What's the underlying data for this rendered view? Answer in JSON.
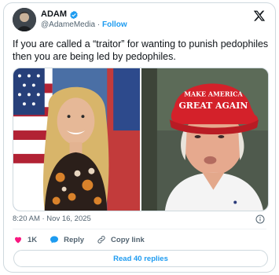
{
  "author": {
    "name": "ADAM",
    "handle": "@AdameMedia",
    "separator": "·",
    "follow_label": "Follow"
  },
  "post": {
    "text": "If you are called a “traitor” for wanting to punish pedophiles then you are being led by pedophiles."
  },
  "media": {
    "right_hat_text_line1": "MAKE AMERICA",
    "right_hat_text_line2": "GREAT AGAIN"
  },
  "timestamp": "8:20 AM · Nov 16, 2025",
  "actions": {
    "like_count": "1K",
    "reply_label": "Reply",
    "copy_label": "Copy link"
  },
  "replies_button": "Read 40 replies",
  "colors": {
    "accent": "#1d9bf0",
    "like": "#f91880",
    "hat": "#d4212a"
  },
  "icons": [
    "x-logo-icon",
    "verified-badge-icon",
    "info-icon",
    "heart-icon",
    "reply-bubble-icon",
    "link-icon"
  ]
}
